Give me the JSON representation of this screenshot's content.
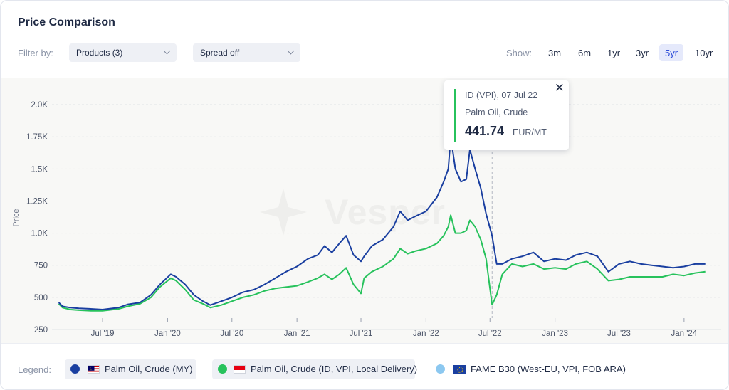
{
  "header": {
    "title": "Price Comparison"
  },
  "filters": {
    "label": "Filter by:",
    "products": "Products (3)",
    "spread": "Spread off"
  },
  "range": {
    "label": "Show:",
    "options": [
      "3m",
      "6m",
      "1yr",
      "3yr",
      "5yr",
      "10yr"
    ],
    "active": "5yr"
  },
  "watermark": "Vesper",
  "tooltip": {
    "header": "ID (VPI), 07 Jul 22",
    "product": "Palm Oil, Crude",
    "value": "441.74",
    "unit": "EUR/MT",
    "close": "✕"
  },
  "legend": {
    "label": "Legend:",
    "items": [
      {
        "name": "Palm Oil, Crude (MY)",
        "color": "#1a3fa0",
        "flag": "MY",
        "active": true
      },
      {
        "name": "Palm Oil, Crude (ID, VPI, Local Delivery)",
        "color": "#27c25c",
        "flag": "ID",
        "active": true
      },
      {
        "name": "FAME B30 (West-EU, VPI, FOB ARA)",
        "color": "#8cc8f0",
        "flag": "EU",
        "active": false
      }
    ]
  },
  "colors": {
    "my": "#1a3fa0",
    "id": "#27c25c",
    "fame": "#8cc8f0",
    "accent": "#2b4bd8"
  },
  "chart_data": {
    "type": "line",
    "ylabel": "Price",
    "ylim": [
      250,
      2100
    ],
    "xlim": [
      "2019-02-20",
      "2024-04-15"
    ],
    "y_ticks": [
      250,
      500,
      750,
      1000,
      1250,
      1500,
      1750,
      2000
    ],
    "y_tick_labels": [
      "250",
      "500",
      "750",
      "1.0K",
      "1.25K",
      "1.5K",
      "1.75K",
      "2.0K"
    ],
    "x_ticks": [
      "2019-07-01",
      "2020-01-01",
      "2020-07-01",
      "2021-01-01",
      "2021-07-01",
      "2022-01-01",
      "2022-07-01",
      "2023-01-01",
      "2023-07-01",
      "2024-01-01"
    ],
    "x_tick_labels": [
      "Jul '19",
      "Jan '20",
      "Jul '20",
      "Jan '21",
      "Jul '21",
      "Jan '22",
      "Jul '22",
      "Jan '23",
      "Jul '23",
      "Jan '24"
    ],
    "grid": true,
    "crosshair_date": "2022-07-07",
    "series": [
      {
        "name": "Palm Oil, Crude (MY)",
        "points": [
          [
            "2019-02-27",
            460
          ],
          [
            "2019-03-10",
            430
          ],
          [
            "2019-04-01",
            420
          ],
          [
            "2019-04-25",
            415
          ],
          [
            "2019-06-01",
            410
          ],
          [
            "2019-07-01",
            405
          ],
          [
            "2019-08-15",
            420
          ],
          [
            "2019-09-10",
            445
          ],
          [
            "2019-10-15",
            460
          ],
          [
            "2019-11-15",
            520
          ],
          [
            "2019-12-10",
            600
          ],
          [
            "2020-01-10",
            680
          ],
          [
            "2020-01-25",
            660
          ],
          [
            "2020-02-20",
            600
          ],
          [
            "2020-03-15",
            520
          ],
          [
            "2020-04-10",
            470
          ],
          [
            "2020-05-01",
            440
          ],
          [
            "2020-06-01",
            470
          ],
          [
            "2020-07-01",
            500
          ],
          [
            "2020-08-01",
            540
          ],
          [
            "2020-09-01",
            560
          ],
          [
            "2020-10-01",
            600
          ],
          [
            "2020-11-01",
            650
          ],
          [
            "2020-12-01",
            700
          ],
          [
            "2021-01-01",
            740
          ],
          [
            "2021-02-01",
            800
          ],
          [
            "2021-03-01",
            830
          ],
          [
            "2021-03-20",
            900
          ],
          [
            "2021-04-10",
            850
          ],
          [
            "2021-05-01",
            920
          ],
          [
            "2021-05-20",
            980
          ],
          [
            "2021-06-10",
            830
          ],
          [
            "2021-07-01",
            780
          ],
          [
            "2021-07-10",
            820
          ],
          [
            "2021-08-01",
            900
          ],
          [
            "2021-09-01",
            950
          ],
          [
            "2021-10-01",
            1050
          ],
          [
            "2021-10-20",
            1170
          ],
          [
            "2021-11-10",
            1100
          ],
          [
            "2021-12-01",
            1130
          ],
          [
            "2022-01-01",
            1170
          ],
          [
            "2022-02-01",
            1280
          ],
          [
            "2022-02-20",
            1400
          ],
          [
            "2022-03-05",
            1500
          ],
          [
            "2022-03-12",
            1750
          ],
          [
            "2022-03-25",
            1500
          ],
          [
            "2022-04-10",
            1400
          ],
          [
            "2022-04-25",
            1420
          ],
          [
            "2022-05-05",
            1650
          ],
          [
            "2022-05-20",
            1500
          ],
          [
            "2022-06-05",
            1350
          ],
          [
            "2022-06-20",
            1150
          ],
          [
            "2022-07-07",
            980
          ],
          [
            "2022-07-20",
            760
          ],
          [
            "2022-08-05",
            760
          ],
          [
            "2022-09-01",
            800
          ],
          [
            "2022-10-01",
            820
          ],
          [
            "2022-11-01",
            850
          ],
          [
            "2022-12-01",
            780
          ],
          [
            "2023-01-01",
            800
          ],
          [
            "2023-02-01",
            790
          ],
          [
            "2023-03-01",
            830
          ],
          [
            "2023-04-01",
            850
          ],
          [
            "2023-05-01",
            820
          ],
          [
            "2023-06-01",
            700
          ],
          [
            "2023-07-01",
            760
          ],
          [
            "2023-08-01",
            780
          ],
          [
            "2023-09-01",
            760
          ],
          [
            "2023-10-01",
            750
          ],
          [
            "2023-11-01",
            740
          ],
          [
            "2023-12-01",
            730
          ],
          [
            "2024-01-01",
            740
          ],
          [
            "2024-02-01",
            760
          ],
          [
            "2024-03-01",
            760
          ]
        ]
      },
      {
        "name": "Palm Oil, Crude (ID, VPI, Local Delivery)",
        "points": [
          [
            "2019-02-27",
            450
          ],
          [
            "2019-03-10",
            420
          ],
          [
            "2019-04-01",
            405
          ],
          [
            "2019-04-25",
            400
          ],
          [
            "2019-06-01",
            395
          ],
          [
            "2019-07-01",
            395
          ],
          [
            "2019-08-15",
            410
          ],
          [
            "2019-09-10",
            430
          ],
          [
            "2019-10-15",
            450
          ],
          [
            "2019-11-15",
            500
          ],
          [
            "2019-12-10",
            580
          ],
          [
            "2020-01-10",
            650
          ],
          [
            "2020-01-25",
            630
          ],
          [
            "2020-02-20",
            560
          ],
          [
            "2020-03-15",
            480
          ],
          [
            "2020-04-10",
            450
          ],
          [
            "2020-05-01",
            420
          ],
          [
            "2020-06-01",
            440
          ],
          [
            "2020-07-01",
            470
          ],
          [
            "2020-08-01",
            500
          ],
          [
            "2020-09-01",
            520
          ],
          [
            "2020-10-01",
            550
          ],
          [
            "2020-11-01",
            570
          ],
          [
            "2020-12-01",
            580
          ],
          [
            "2021-01-01",
            590
          ],
          [
            "2021-02-01",
            620
          ],
          [
            "2021-03-01",
            650
          ],
          [
            "2021-03-20",
            680
          ],
          [
            "2021-04-10",
            640
          ],
          [
            "2021-05-01",
            680
          ],
          [
            "2021-05-20",
            730
          ],
          [
            "2021-06-10",
            600
          ],
          [
            "2021-07-01",
            530
          ],
          [
            "2021-07-10",
            650
          ],
          [
            "2021-08-01",
            700
          ],
          [
            "2021-09-01",
            740
          ],
          [
            "2021-10-01",
            800
          ],
          [
            "2021-10-20",
            880
          ],
          [
            "2021-11-10",
            840
          ],
          [
            "2021-12-01",
            860
          ],
          [
            "2022-01-01",
            880
          ],
          [
            "2022-02-01",
            920
          ],
          [
            "2022-02-20",
            980
          ],
          [
            "2022-03-05",
            1050
          ],
          [
            "2022-03-12",
            1140
          ],
          [
            "2022-03-25",
            1000
          ],
          [
            "2022-04-10",
            1000
          ],
          [
            "2022-04-25",
            1020
          ],
          [
            "2022-05-05",
            1100
          ],
          [
            "2022-05-20",
            1050
          ],
          [
            "2022-06-05",
            950
          ],
          [
            "2022-06-20",
            800
          ],
          [
            "2022-07-07",
            442
          ],
          [
            "2022-07-20",
            520
          ],
          [
            "2022-08-05",
            680
          ],
          [
            "2022-09-01",
            760
          ],
          [
            "2022-10-01",
            740
          ],
          [
            "2022-11-01",
            760
          ],
          [
            "2022-12-01",
            720
          ],
          [
            "2023-01-01",
            730
          ],
          [
            "2023-02-01",
            720
          ],
          [
            "2023-03-01",
            760
          ],
          [
            "2023-04-01",
            780
          ],
          [
            "2023-05-01",
            720
          ],
          [
            "2023-06-01",
            630
          ],
          [
            "2023-07-01",
            640
          ],
          [
            "2023-08-01",
            660
          ],
          [
            "2023-09-01",
            660
          ],
          [
            "2023-10-01",
            660
          ],
          [
            "2023-11-01",
            660
          ],
          [
            "2023-12-01",
            680
          ],
          [
            "2024-01-01",
            670
          ],
          [
            "2024-02-01",
            690
          ],
          [
            "2024-03-01",
            700
          ]
        ]
      }
    ]
  }
}
